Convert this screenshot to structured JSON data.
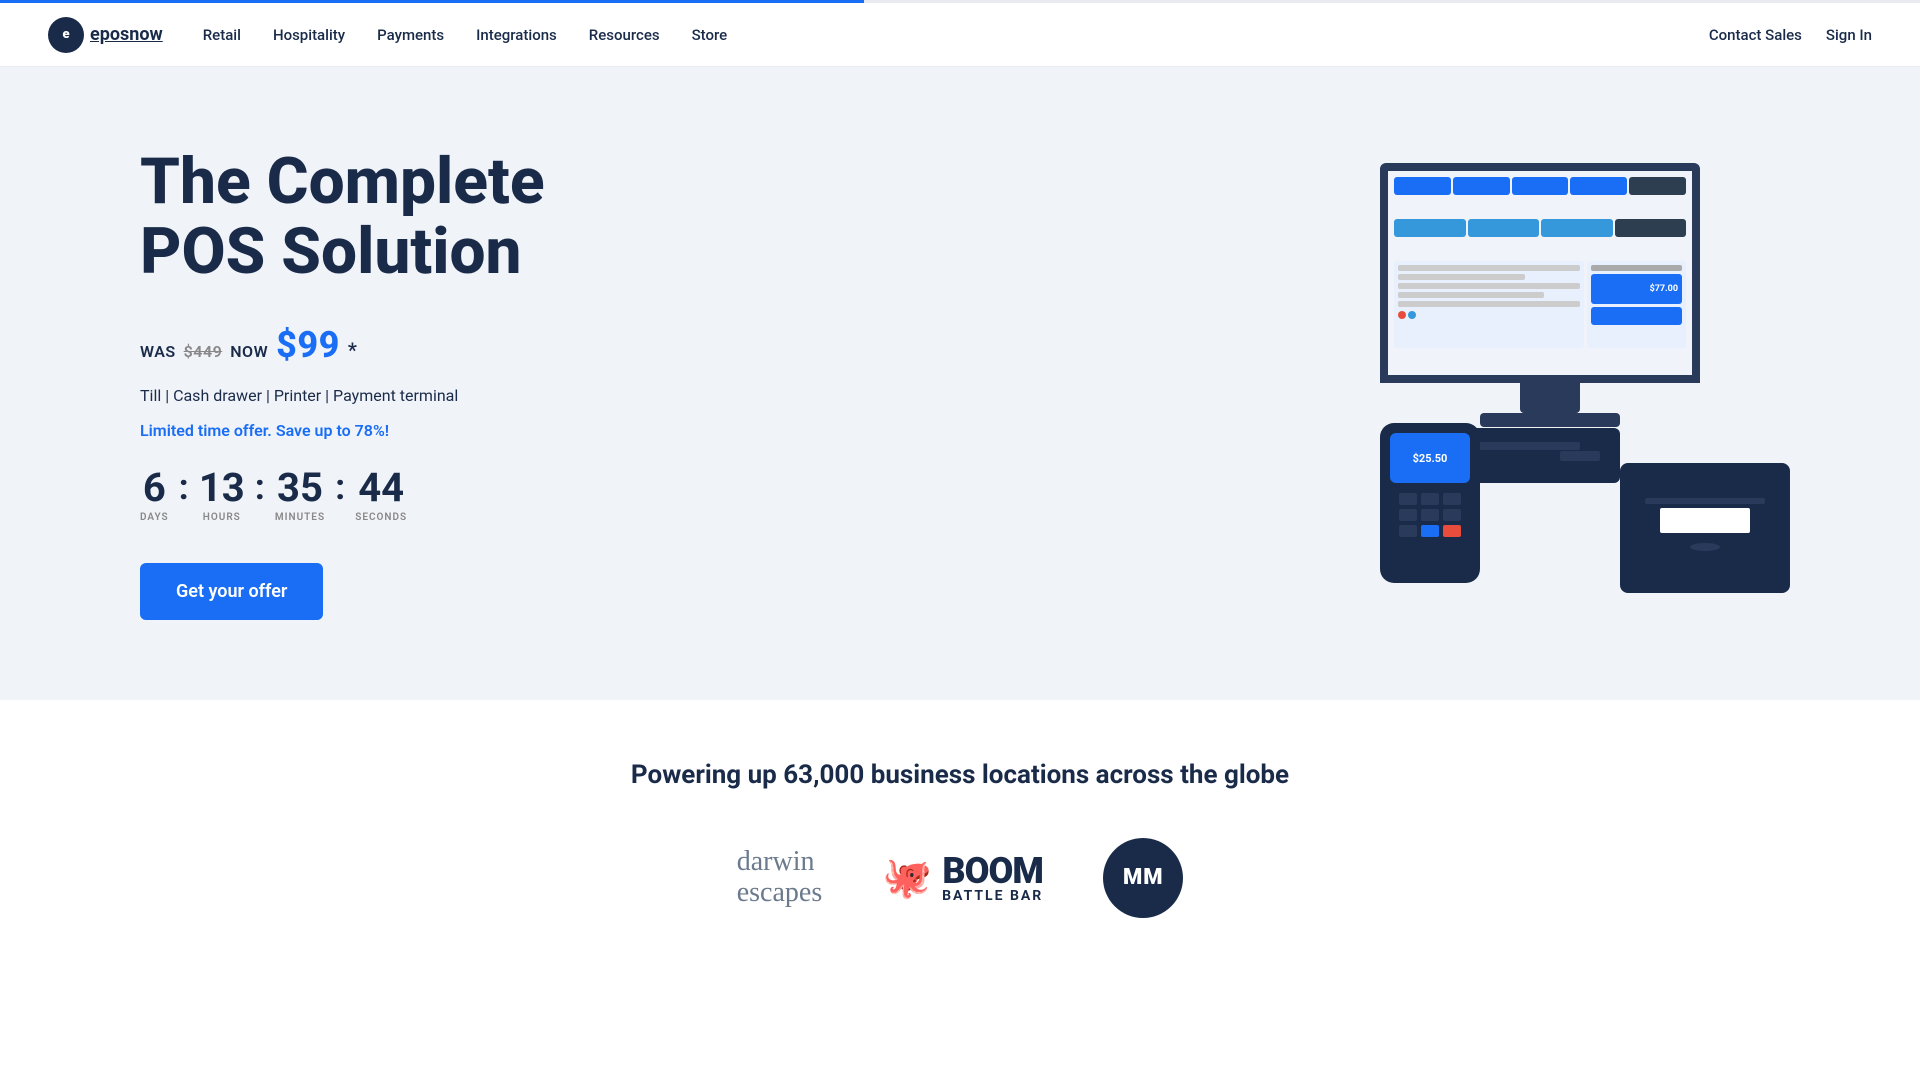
{
  "nav": {
    "logo_text": "eposnow",
    "logo_letter": "e",
    "links": [
      {
        "label": "Retail",
        "href": "#"
      },
      {
        "label": "Hospitality",
        "href": "#"
      },
      {
        "label": "Payments",
        "href": "#"
      },
      {
        "label": "Integrations",
        "href": "#"
      },
      {
        "label": "Resources",
        "href": "#"
      },
      {
        "label": "Store",
        "href": "#"
      }
    ],
    "contact_sales": "Contact Sales",
    "sign_in": "Sign In"
  },
  "hero": {
    "title": "The Complete POS Solution",
    "price_was_label": "WAS",
    "price_was_value": "$449",
    "price_now_label": "NOW",
    "price_now_value": "$99",
    "price_asterisk": "*",
    "includes": "Till | Cash drawer | Printer | Payment terminal",
    "limited_offer": "Limited time offer.",
    "save_text": "Save up to 78%!",
    "countdown": {
      "days_value": "6",
      "days_label": "DAYS",
      "hours_value": "13",
      "hours_label": "HOURS",
      "minutes_value": "35",
      "minutes_label": "MINUTES",
      "seconds_value": "44",
      "seconds_label": "SECONDS"
    },
    "cta_button": "Get your offer"
  },
  "bottom": {
    "title": "Powering up 63,000 business locations across the globe",
    "brands": [
      {
        "name": "Darwin Escapes",
        "type": "text",
        "line1": "darwin",
        "line2": "escapes"
      },
      {
        "name": "Boom Battle Bar",
        "type": "boom"
      },
      {
        "name": "MM",
        "type": "circle",
        "text": "MM"
      }
    ]
  },
  "colors": {
    "primary_blue": "#1a6ef5",
    "dark_navy": "#1a2b4a",
    "hero_bg": "#f0f3f8",
    "white": "#ffffff"
  }
}
